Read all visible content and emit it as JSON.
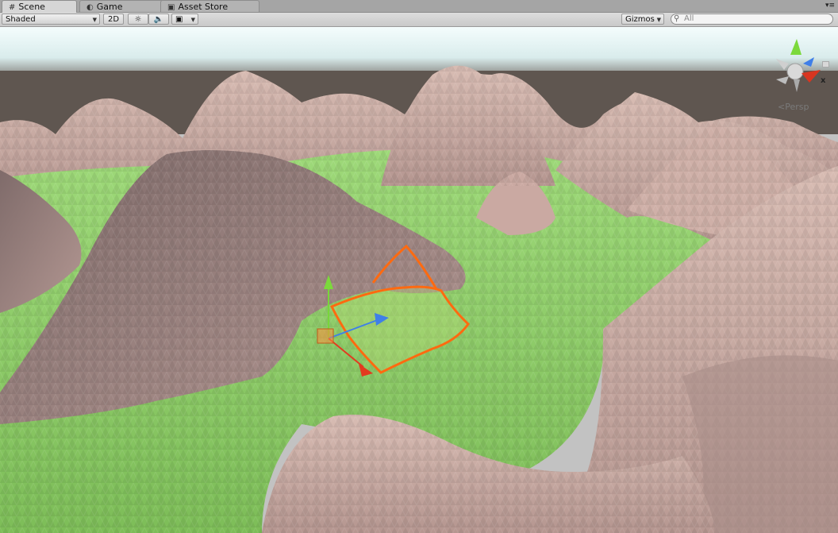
{
  "tabs": [
    {
      "label": "Scene",
      "icon": "grid-icon",
      "active": true
    },
    {
      "label": "Game",
      "icon": "pacman-icon",
      "active": false
    },
    {
      "label": "Asset Store",
      "icon": "store-icon",
      "active": false
    }
  ],
  "toolbar": {
    "shading_mode": "Shaded",
    "mode_2d_label": "2D",
    "gizmos_label": "Gizmos",
    "search_placeholder": "All"
  },
  "scene": {
    "projection_label": "Persp",
    "axis_x_label": "x",
    "colors": {
      "sky_top": "#f2fbfc",
      "horizon": "#5f5650",
      "grass": "#8fcf6a",
      "mountain": "#c9a9a0",
      "mountain_shadow": "#8e7773",
      "selection": "#ff7a14",
      "axis_x": "#e33a1f",
      "axis_y": "#7bd93b",
      "axis_z": "#3f7fe8"
    }
  }
}
